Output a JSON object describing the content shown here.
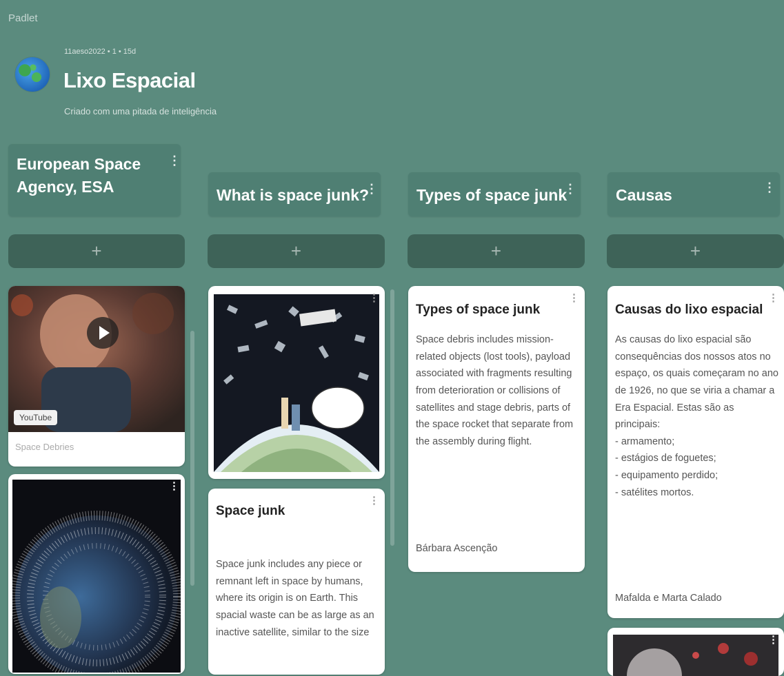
{
  "app": {
    "brand": "Padlet"
  },
  "board": {
    "meta": "11aeso2022 • 1 • 15d",
    "title": "Lixo Espacial",
    "subtitle": "Criado com uma pitada de inteligência"
  },
  "columns": [
    {
      "title": "European Space Agency, ESA",
      "add_label": "+"
    },
    {
      "title": "What is space junk?",
      "add_label": "+"
    },
    {
      "title": "Types of space junk",
      "add_label": "+"
    },
    {
      "title": "Causas",
      "add_label": "+"
    }
  ],
  "icons": {
    "kebab": "⋮"
  },
  "cards": {
    "esa_video": {
      "source": "YouTube",
      "caption": "Space Debries"
    },
    "space_junk": {
      "title": "Space junk",
      "body": "Space junk includes any piece or remnant left in space by humans, where its origin is on Earth. This spacial waste can be as large as an inactive satellite, similar to the size"
    },
    "types": {
      "title": "Types of space junk",
      "body": "Space debris includes mission-related objects (lost tools), payload associated with fragments resulting from deterioration or collisions of satellites and stage debris, parts of the space rocket that separate from the assembly during flight.",
      "author": "Bárbara Ascenção"
    },
    "causas": {
      "title": "Causas do lixo espacial",
      "body": " As causas do lixo espacial são consequências dos nossos atos no espaço, os quais começaram no ano de 1926, no que se viria a chamar a Era Espacial. Estas são as principais:\n- armamento;\n- estágios de foguetes;\n- equipamento perdido;\n- satélites mortos.",
      "author": "Mafalda e Marta Calado"
    }
  },
  "colors": {
    "background": "#5b8b7e",
    "column_header": "#4f7f73",
    "add_button": "#3e6358",
    "card": "#ffffff"
  }
}
